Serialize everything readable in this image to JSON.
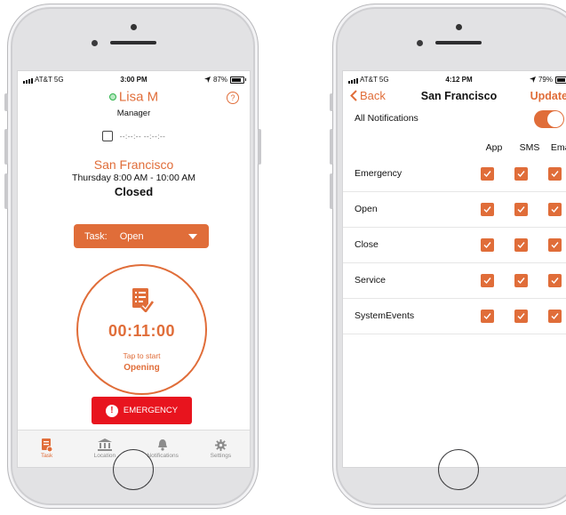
{
  "left_phone": {
    "status": {
      "carrier": "AT&T 5G",
      "time": "3:00 PM",
      "battery": "87%",
      "battery_level": 0.87
    },
    "user": {
      "name": "Lisa M",
      "role": "Manager"
    },
    "checkin_placeholder": "--:--:-- --:--:--",
    "location": {
      "name": "San Francisco",
      "hours": "Thursday 8:00 AM - 10:00 AM",
      "status": "Closed"
    },
    "task": {
      "label": "Task:",
      "value": "Open"
    },
    "timer": {
      "value": "00:11:00",
      "hint": "Tap to start",
      "action": "Opening"
    },
    "emergency_label": "EMERGENCY",
    "tabs": [
      {
        "label": "Task",
        "icon": "task-icon",
        "active": true
      },
      {
        "label": "Location",
        "icon": "bank-icon",
        "active": false
      },
      {
        "label": "Notifications",
        "icon": "bell-icon",
        "active": false
      },
      {
        "label": "Settings",
        "icon": "gear-icon",
        "active": false
      }
    ]
  },
  "right_phone": {
    "status": {
      "carrier": "AT&T 5G",
      "time": "4:12 PM",
      "battery": "79%",
      "battery_level": 0.79
    },
    "nav": {
      "back": "Back",
      "title": "San Francisco",
      "action": "Update"
    },
    "all_notifications": {
      "label": "All Notifications",
      "enabled": true
    },
    "columns": [
      "App",
      "SMS",
      "Email"
    ],
    "rows": [
      {
        "label": "Emergency",
        "app": true,
        "sms": true,
        "email": true
      },
      {
        "label": "Open",
        "app": true,
        "sms": true,
        "email": true
      },
      {
        "label": "Close",
        "app": true,
        "sms": true,
        "email": true
      },
      {
        "label": "Service",
        "app": true,
        "sms": true,
        "email": true
      },
      {
        "label": "SystemEvents",
        "app": true,
        "sms": true,
        "email": true
      }
    ]
  },
  "colors": {
    "accent": "#e06d39",
    "emergency": "#e8141e",
    "online": "#2db34a"
  }
}
